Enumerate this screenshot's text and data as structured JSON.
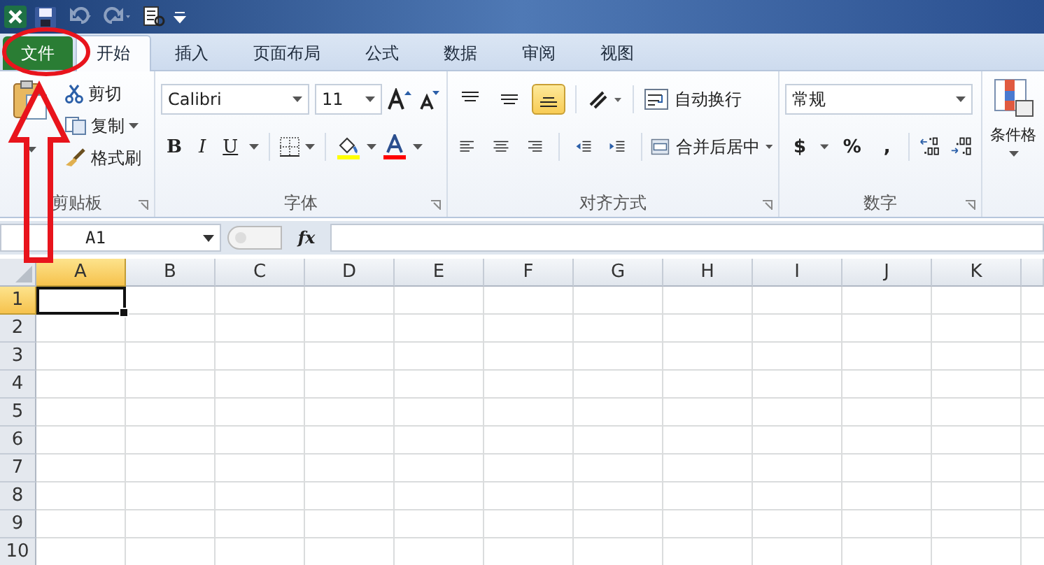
{
  "tabs": [
    {
      "label": "文件",
      "kind": "file",
      "selected": false
    },
    {
      "label": "开始",
      "kind": "tab",
      "selected": true
    },
    {
      "label": "插入",
      "kind": "tab",
      "selected": false
    },
    {
      "label": "页面布局",
      "kind": "tab",
      "selected": false
    },
    {
      "label": "公式",
      "kind": "tab",
      "selected": false
    },
    {
      "label": "数据",
      "kind": "tab",
      "selected": false
    },
    {
      "label": "审阅",
      "kind": "tab",
      "selected": false
    },
    {
      "label": "视图",
      "kind": "tab",
      "selected": false
    }
  ],
  "clipboard": {
    "items": [
      {
        "kind": "cut",
        "label": "剪切"
      },
      {
        "kind": "copy",
        "label": "复制"
      },
      {
        "kind": "painter",
        "label": "格式刷"
      }
    ],
    "group_label": "剪贴板"
  },
  "font": {
    "name": "Calibri",
    "size": "11",
    "styles": [
      "B",
      "I",
      "U"
    ],
    "group_label": "字体"
  },
  "alignment": {
    "vertical": [
      {
        "kind": "top",
        "selected": false
      },
      {
        "kind": "middle",
        "selected": false
      },
      {
        "kind": "bottom",
        "selected": true
      }
    ],
    "wrap": "自动换行",
    "merge": "合并后居中",
    "group_label": "对齐方式"
  },
  "number": {
    "format": "常规",
    "symbols": [
      "$",
      "%",
      ","
    ],
    "group_label": "数字"
  },
  "styles": {
    "conditional": "条件格"
  },
  "name_box": "A1",
  "formula_icon": "fx",
  "columns": [
    {
      "label": "A",
      "selected": true
    },
    {
      "label": "B",
      "selected": false
    },
    {
      "label": "C",
      "selected": false
    },
    {
      "label": "D",
      "selected": false
    },
    {
      "label": "E",
      "selected": false
    },
    {
      "label": "F",
      "selected": false
    },
    {
      "label": "G",
      "selected": false
    },
    {
      "label": "H",
      "selected": false
    },
    {
      "label": "I",
      "selected": false
    },
    {
      "label": "J",
      "selected": false
    },
    {
      "label": "K",
      "selected": false
    }
  ],
  "rows": [
    {
      "label": "1",
      "selected": true
    },
    {
      "label": "2",
      "selected": false
    },
    {
      "label": "3",
      "selected": false
    },
    {
      "label": "4",
      "selected": false
    },
    {
      "label": "5",
      "selected": false
    },
    {
      "label": "6",
      "selected": false
    },
    {
      "label": "7",
      "selected": false
    },
    {
      "label": "8",
      "selected": false
    },
    {
      "label": "9",
      "selected": false
    },
    {
      "label": "10",
      "selected": false
    }
  ]
}
